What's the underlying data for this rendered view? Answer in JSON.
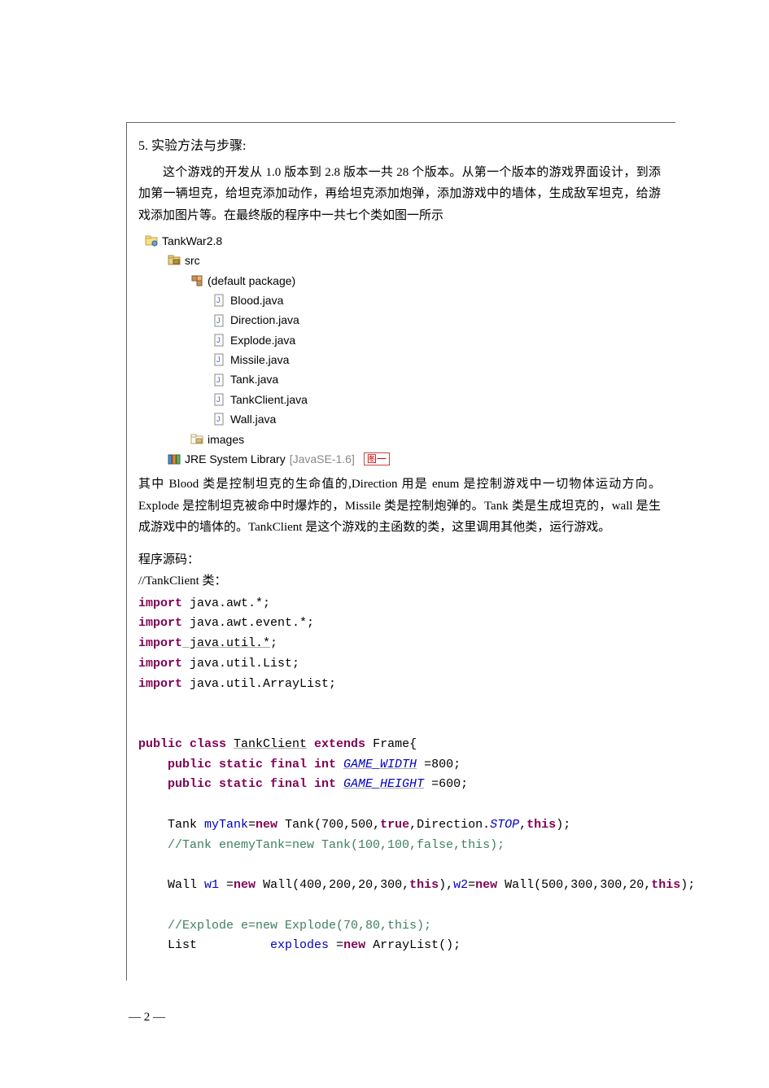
{
  "section": {
    "title": "5. 实验方法与步骤:"
  },
  "para1": "这个游戏的开发从 1.0 版本到 2.8 版本一共 28 个版本。从第一个版本的游戏界面设计，到添加第一辆坦克，给坦克添加动作，再给坦克添加炮弹，添加游戏中的墙体，生成敌军坦克，给游戏添加图片等。在最终版的程序中一共七个类如图一所示",
  "tree": {
    "project": "TankWar2.8",
    "src": "src",
    "pkg": "(default package)",
    "files": [
      "Blood.java",
      "Direction.java",
      "Explode.java",
      "Missile.java",
      "Tank.java",
      "TankClient.java",
      "Wall.java"
    ],
    "images": "images",
    "lib": "JRE System Library",
    "libver": "[JavaSE-1.6]",
    "fig": "图一"
  },
  "para2": "其中 Blood 类是控制坦克的生命值的,Direction 用是 enum 是控制游戏中一切物体运动方向。Explode 是控制坦克被命中时爆炸的，Missile 类是控制炮弹的。Tank 类是生成坦克的，wall 是生成游戏中的墙体的。TankClient 是这个游戏的主函数的类，这里调用其他类，运行游戏。",
  "srclabel": " 程序源码：",
  "tankclient": "//TankClient 类：",
  "code": {
    "line01a": "import",
    "line01b": " java.awt.*;",
    "line02a": "import",
    "line02b": " java.awt.event.*;",
    "line03a": "import",
    "line03b_u": " java.util.*",
    "line03c": ";",
    "line04a": "import",
    "line04b": " java.util.List;",
    "line05a": "import",
    "line05b": " java.util.ArrayList;",
    "blank": "",
    "line06a": "public class ",
    "line06u": "TankClient",
    "line06b": " extends",
    "line06c": " Frame{",
    "line07a": "    public static final int ",
    "line07i": "GAME_WIDTH",
    "line07c": " =800;",
    "line08a": "    public static final int ",
    "line08i": "GAME_HEIGHT",
    "line08c": " =600;",
    "line09a": "    Tank ",
    "line09b": "myTank",
    "line09c": "=",
    "line09d": "new",
    "line09e": " Tank(700,500,",
    "line09f": "true",
    "line09g": ",Direction.",
    "line09h": "STOP",
    "line09i": ",",
    "line09j": "this",
    "line09k": ");",
    "line10": "    //Tank enemyTank=new Tank(100,100,false,this);",
    "line11a": "    Wall ",
    "line11b": "w1",
    "line11c": " =",
    "line11d": "new",
    "line11e": " Wall(400,200,20,300,",
    "line11f": "this",
    "line11g": "),",
    "line11h": "w2",
    "line11i": "=",
    "line11j": "new",
    "line11k": " Wall(500,300,300,20,",
    "line11l": "this",
    "line11m": ");",
    "line12": "    //Explode e=new Explode(70,80,this);",
    "line13a": "    List          ",
    "line13b": "explodes",
    "line13c": " =",
    "line13d": "new",
    "line13e": " ArrayList();"
  },
  "footer": "— 2 —"
}
